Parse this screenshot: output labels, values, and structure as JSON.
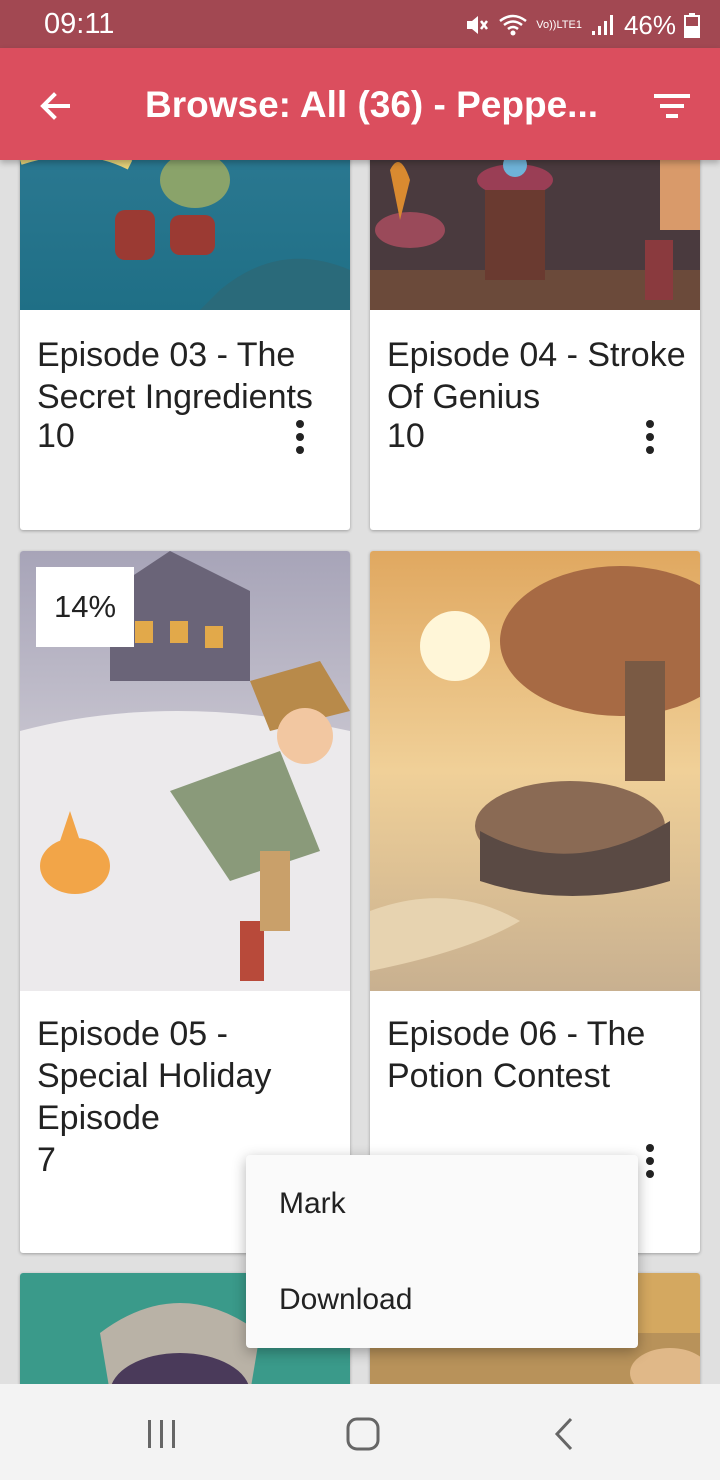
{
  "status_bar": {
    "time": "09:11",
    "network_label_top": "Vo))",
    "network_label_bottom": "LTE1",
    "battery": "46%"
  },
  "app_bar": {
    "title": "Browse: All (36) - Peppe...",
    "back_icon": "arrow-left-icon",
    "filter_icon": "filter-icon"
  },
  "cards": [
    {
      "title": "Episode 03 - The Secret Ingredients",
      "count": "10"
    },
    {
      "title": "Episode 04 - Stroke Of Genius",
      "count": "10"
    },
    {
      "title": "Episode 05 - Special Holiday Episode",
      "count": "7",
      "progress": "14%"
    },
    {
      "title": "Episode 06 - The Potion Contest",
      "count": ""
    }
  ],
  "popup_menu": {
    "items": [
      "Mark",
      "Download"
    ]
  },
  "colors": {
    "status_bar": "#a24852",
    "app_bar": "#db4e5e",
    "background": "#e0e0e0"
  }
}
